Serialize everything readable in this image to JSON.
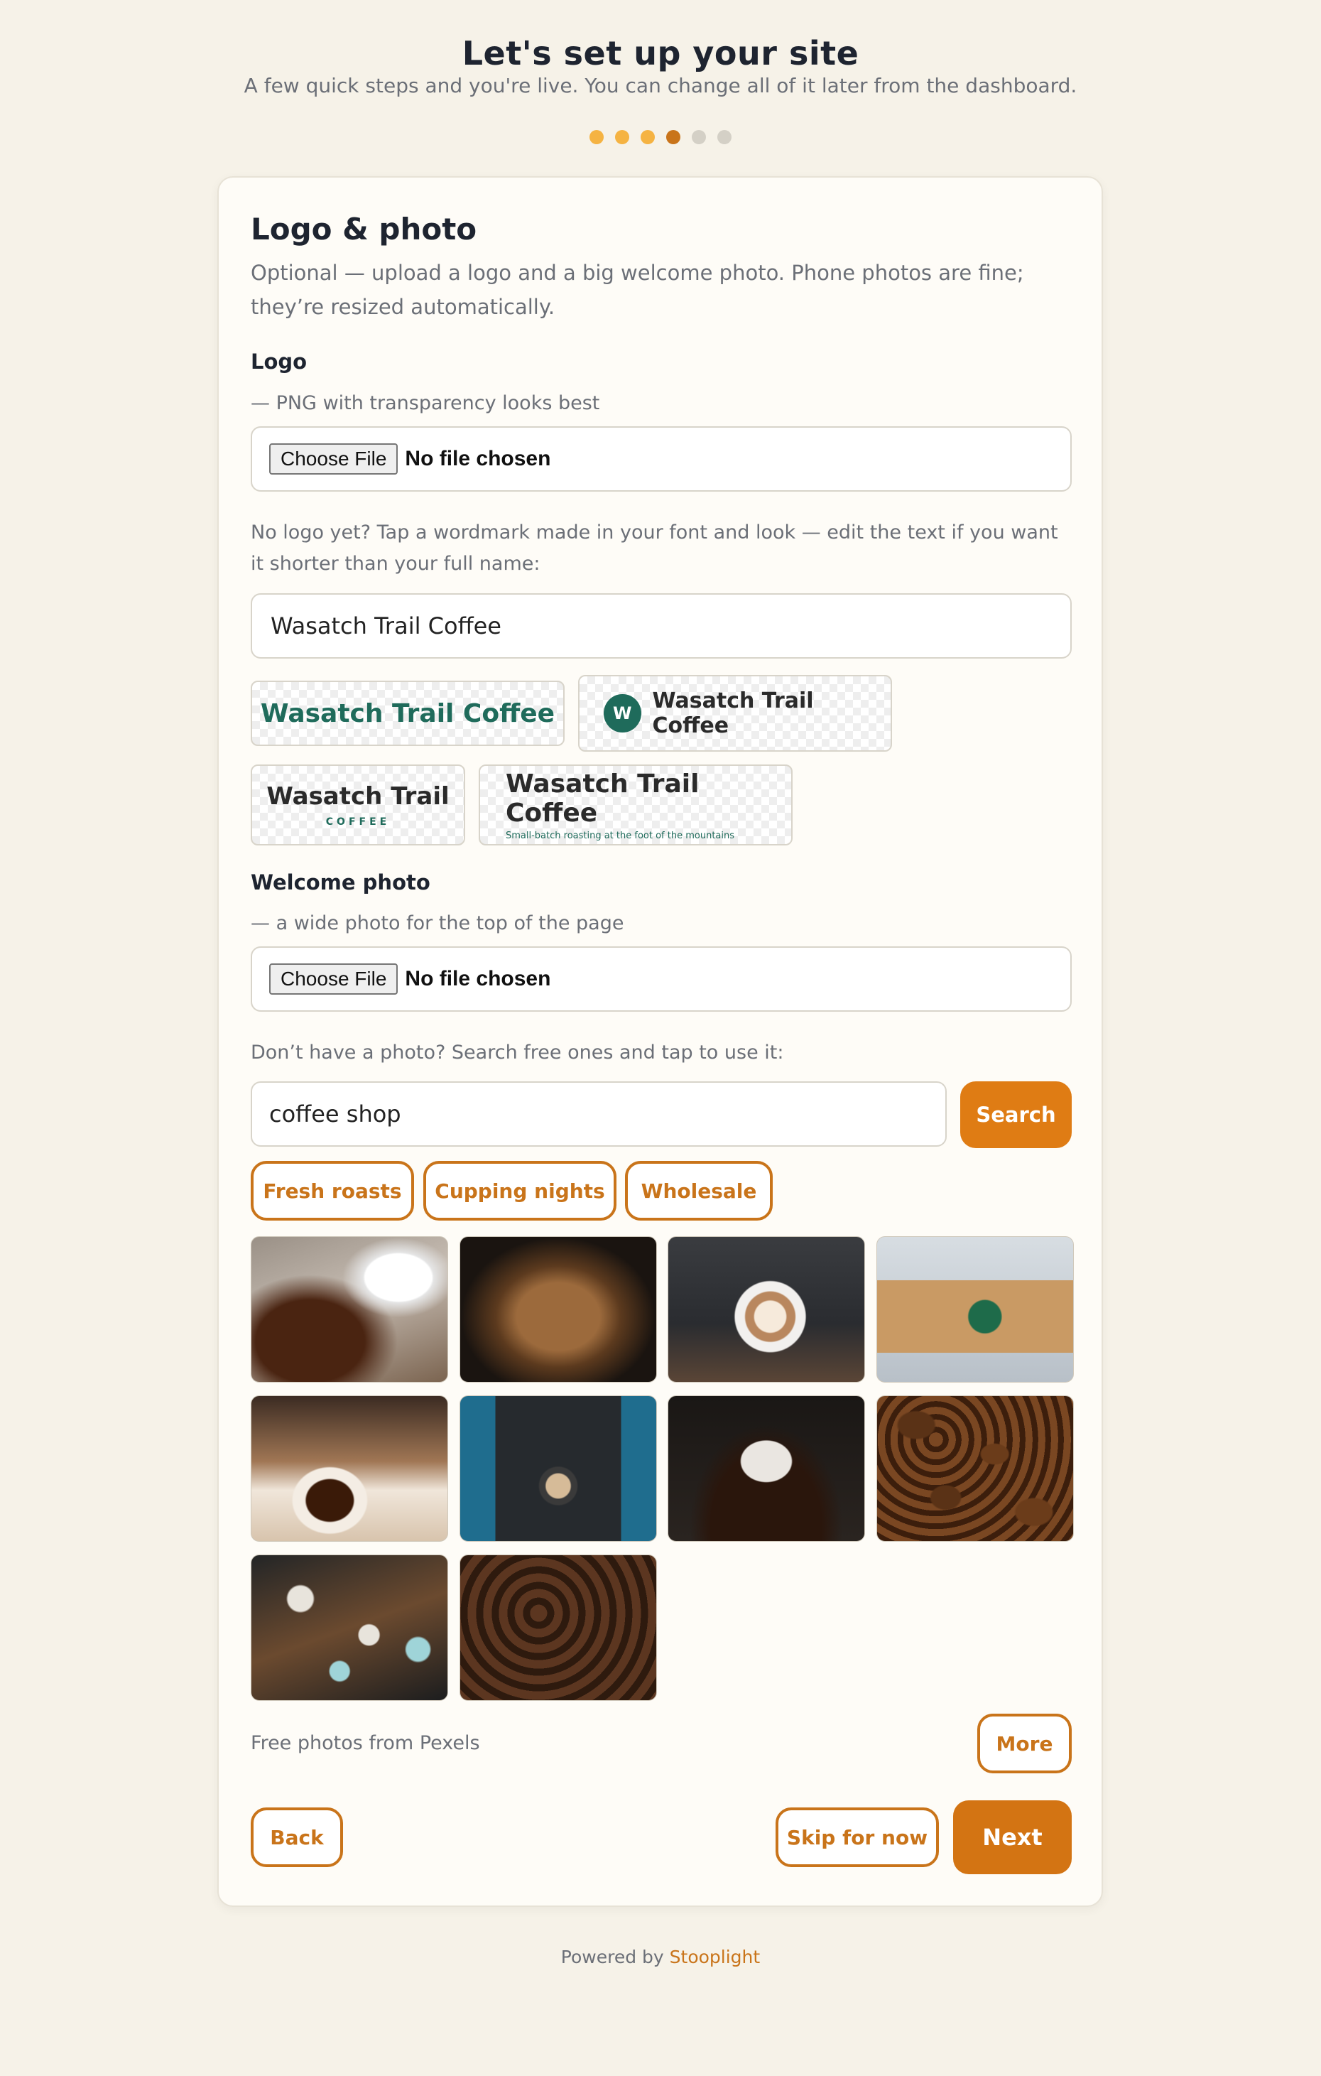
{
  "header": {
    "title": "Let's set up your site",
    "subtitle": "A few quick steps and you're live. You can change all of it later from the dashboard.",
    "steps": [
      "done",
      "done",
      "done",
      "current",
      "todo",
      "todo"
    ]
  },
  "section": {
    "title": "Logo & photo",
    "description": "Optional — upload a logo and a big welcome photo. Phone photos are fine; they’re resized automatically."
  },
  "logo": {
    "label": "Logo",
    "hint": "— PNG with transparency looks best",
    "choose_file_label": "Choose File",
    "file_status": "No file chosen",
    "wordmark_prompt": "No logo yet? Tap a wordmark made in your font and look — edit the text if you want it shorter than your full name:",
    "wordmark_text": "Wasatch Trail Coffee",
    "wordmarks": {
      "plain": "Wasatch Trail Coffee",
      "badge_initial": "W",
      "badge_text": "Wasatch Trail Coffee",
      "stacked_main": "Wasatch Trail",
      "stacked_sub": "COFFEE",
      "tagline_main": "Wasatch Trail Coffee",
      "tagline_sub": "Small-batch roasting at the foot of the mountains"
    }
  },
  "welcome_photo": {
    "label": "Welcome photo",
    "hint": "— a wide photo for the top of the page",
    "choose_file_label": "Choose File",
    "file_status": "No file chosen",
    "search_prompt": "Don’t have a photo? Search free ones and tap to use it:",
    "search_value": "coffee shop",
    "search_button": "Search",
    "chips": [
      "Fresh roasts",
      "Cupping nights",
      "Wholesale"
    ],
    "credit": "Free photos from Pexels",
    "more_button": "More"
  },
  "nav": {
    "back": "Back",
    "skip": "Skip for now",
    "next": "Next"
  },
  "footer": {
    "prefix": "Powered by ",
    "brand": "Stooplight"
  },
  "colors": {
    "accent": "#d37413",
    "brand_green": "#1f6b5b",
    "background": "#f6f2e8"
  }
}
